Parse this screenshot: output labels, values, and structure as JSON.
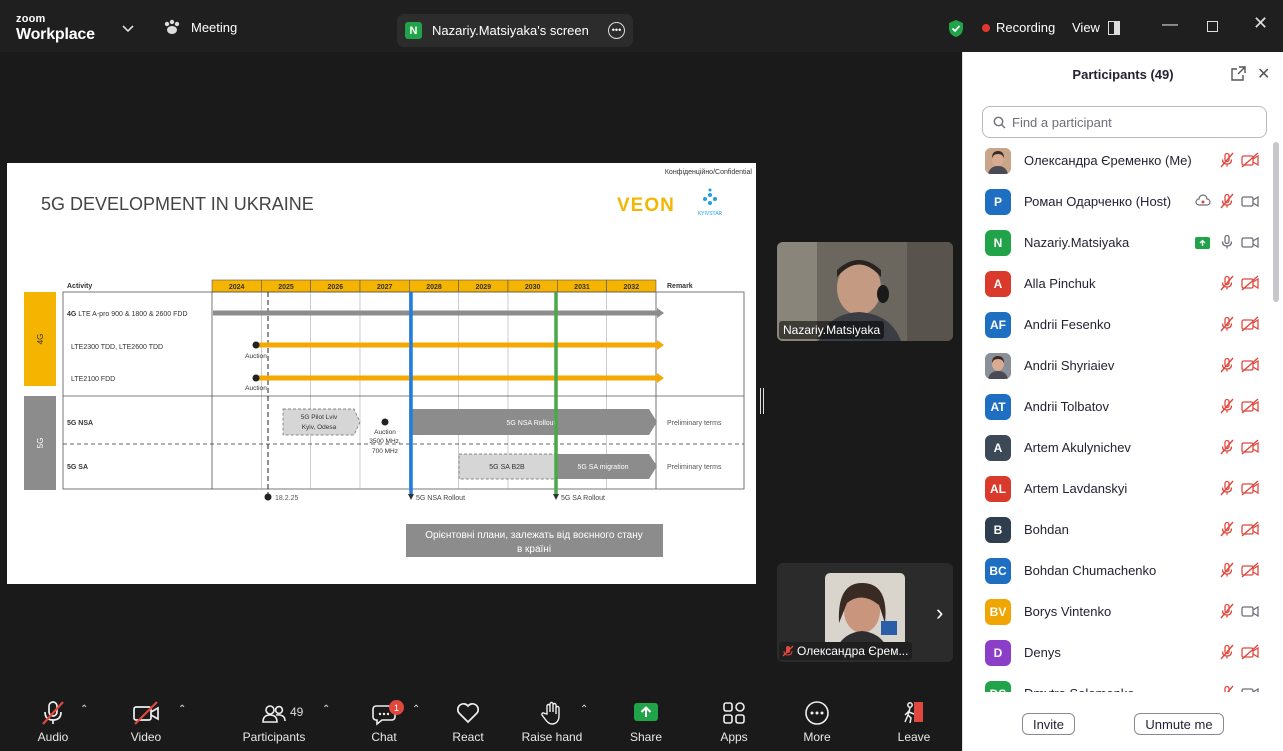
{
  "titlebar": {
    "brand_top": "zoom",
    "brand_bottom": "Workplace",
    "meeting_label": "Meeting",
    "share_initial": "N",
    "share_title": "Nazariy.Matsiyaka's screen",
    "recording_label": "Recording",
    "view_label": "View"
  },
  "slide": {
    "confidential": "Конфіденційно/Confidential",
    "title": "5G DEVELOPMENT IN UKRAINE",
    "brand": "VEON",
    "brand2": "KYIVSTAR",
    "activity_header": "Activity",
    "remark_header": "Remark",
    "years": [
      "2024",
      "2025",
      "2026",
      "2027",
      "2028",
      "2029",
      "2030",
      "2031",
      "2032"
    ],
    "band_4g": "4G",
    "band_5g": "5G",
    "rows": {
      "r1_bold": "4G",
      "r1_text": "LTE A-pro 900 & 1800 & 2600 FDD",
      "r2_text": "LTE2300 TDD, LTE2600 TDD",
      "r3_text": "LTE2100 FDD",
      "r4_text": "5G NSA",
      "r5_text": "5G SA"
    },
    "auction": "Auction",
    "pilot_line1": "5G Pilot Lviv",
    "pilot_line2": "Kyiv, Odesa",
    "auction_5g_line1": "Auction",
    "auction_5g_line2": "3500 MHz,",
    "auction_5g_line3": "700 MHz",
    "nsa_rollout_bar": "5G NSA Rollout",
    "sa_b2b": "5G SA B2B",
    "sa_migration": "5G SA migration",
    "preliminary": "Preliminary terms",
    "date_marker": "18.2.25",
    "nsa_rollout_marker": "5G NSA Rollout",
    "sa_rollout_marker": "5G SA Rollout",
    "note_line1": "Орієнтовні плани, залежать від воєнного стану",
    "note_line2": "в країні"
  },
  "videos": {
    "speaker": "Nazariy.Matsiyaka",
    "self": "Олександра Єрем..."
  },
  "panel": {
    "title": "Participants (49)",
    "search_placeholder": "Find a participant",
    "participants": [
      {
        "name": "Олександра Єременко (Me)",
        "initials": "",
        "color": "#c9a58a",
        "photo": true
      },
      {
        "name": "Роман Одарченко (Host)",
        "initials": "P",
        "color": "#1e6fc2"
      },
      {
        "name": "Nazariy.Matsiyaka",
        "initials": "N",
        "color": "#21a34a"
      },
      {
        "name": "Alla Pinchuk",
        "initials": "A",
        "color": "#d93a2b"
      },
      {
        "name": "Andrii Fesenko",
        "initials": "AF",
        "color": "#1e6fc2"
      },
      {
        "name": "Andrii Shyriaiev",
        "initials": "",
        "color": "#8a8f98",
        "photo": true
      },
      {
        "name": "Andrii Tolbatov",
        "initials": "AT",
        "color": "#1e6fc2"
      },
      {
        "name": "Artem Akulynichev",
        "initials": "A",
        "color": "#3c4a57"
      },
      {
        "name": "Artem Lavdanskyi",
        "initials": "AL",
        "color": "#d93a2b"
      },
      {
        "name": "Bohdan",
        "initials": "B",
        "color": "#2f3e4e"
      },
      {
        "name": "Bohdan Chumachenko",
        "initials": "BC",
        "color": "#1e6fc2"
      },
      {
        "name": "Borys Vintenko",
        "initials": "BV",
        "color": "#f0a500"
      },
      {
        "name": "Denys",
        "initials": "D",
        "color": "#8b3ec7"
      },
      {
        "name": "Dmytro Solomonko",
        "initials": "DS",
        "color": "#21a34a"
      }
    ],
    "invite_label": "Invite",
    "unmute_label": "Unmute me"
  },
  "toolbar": {
    "audio": "Audio",
    "video": "Video",
    "participants": "Participants",
    "participants_count": "49",
    "chat": "Chat",
    "chat_badge": "1",
    "react": "React",
    "raise_hand": "Raise hand",
    "share": "Share",
    "apps": "Apps",
    "more": "More",
    "leave": "Leave"
  },
  "colors": {
    "share_green": "#21a34a",
    "recording_red": "#e5352f",
    "muted_red": "#e0483e",
    "orange": "#f5a800",
    "blue_line": "#1f7ee0",
    "green_line": "#4aa84a"
  }
}
